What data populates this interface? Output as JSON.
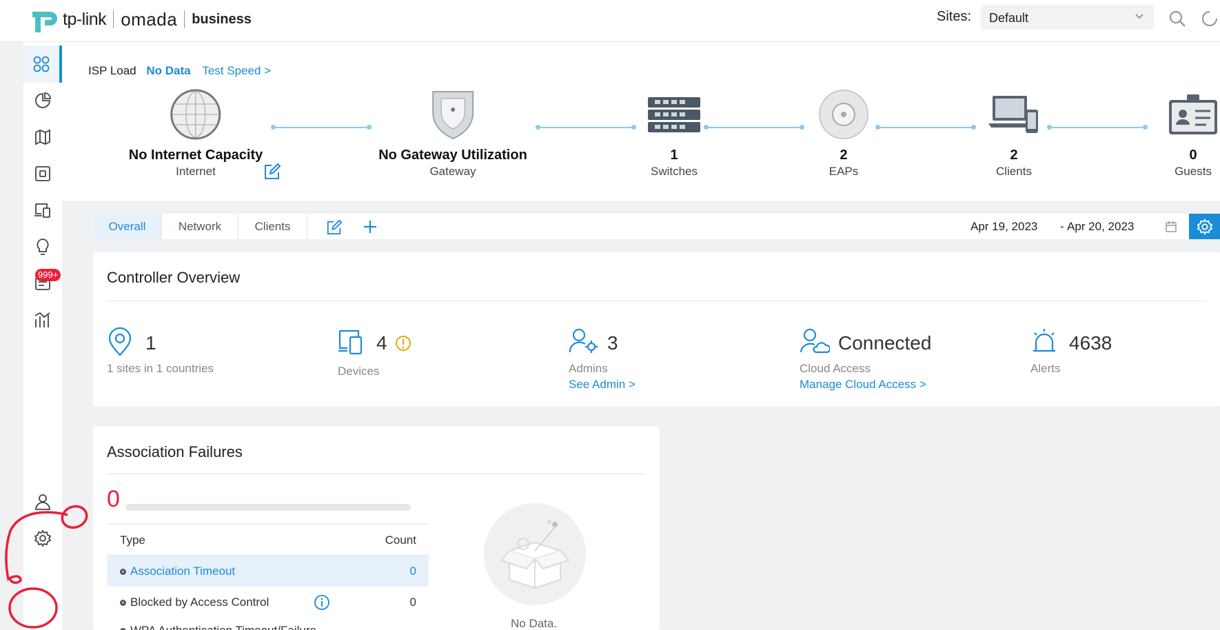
{
  "header": {
    "brand": "tp-link",
    "product": "omada",
    "edition": "business",
    "sites_label": "Sites:",
    "site_selected": "Default"
  },
  "sidebar": {
    "items": [
      {
        "name": "dashboard",
        "active": true
      },
      {
        "name": "statistics"
      },
      {
        "name": "map"
      },
      {
        "name": "devices"
      },
      {
        "name": "clients"
      },
      {
        "name": "insight"
      },
      {
        "name": "logs",
        "badge": "999+"
      },
      {
        "name": "reports"
      }
    ],
    "bottom": [
      {
        "name": "account"
      },
      {
        "name": "settings"
      }
    ]
  },
  "topology": {
    "isp_label": "ISP Load",
    "isp_value": "No Data",
    "test_speed": "Test Speed >",
    "nodes": [
      {
        "value": "No Internet Capacity",
        "label": "Internet"
      },
      {
        "value": "No Gateway Utilization",
        "label": "Gateway"
      },
      {
        "value": "1",
        "label": "Switches"
      },
      {
        "value": "2",
        "label": "EAPs"
      },
      {
        "value": "2",
        "label": "Clients"
      },
      {
        "value": "0",
        "label": "Guests"
      }
    ]
  },
  "tabs": {
    "items": [
      "Overall",
      "Network",
      "Clients"
    ],
    "active": "Overall",
    "date_start": "Apr 19, 2023",
    "date_sep": "-",
    "date_end": "Apr 20, 2023"
  },
  "overview": {
    "title": "Controller Overview",
    "stats": [
      {
        "num": "1",
        "sub": "1 sites in 1 countries"
      },
      {
        "num": "4",
        "sub": "Devices"
      },
      {
        "num": "3",
        "sub": "Admins",
        "link": "See Admin >"
      },
      {
        "num": "Connected",
        "sub": "Cloud Access",
        "link": "Manage Cloud Access >"
      },
      {
        "num": "4638",
        "sub": "Alerts"
      }
    ]
  },
  "failures": {
    "title": "Association Failures",
    "total": "0",
    "col_type": "Type",
    "col_count": "Count",
    "rows": [
      {
        "type": "Association Timeout",
        "count": "0"
      },
      {
        "type": "Blocked by Access Control",
        "count": "0"
      },
      {
        "type": "WPA Authentication Timeout/Failure",
        "count": ""
      }
    ],
    "empty_text": "No Data."
  },
  "colors": {
    "accent": "#1a8cd8",
    "alert": "#e8203b",
    "warning": "#f0a500"
  }
}
